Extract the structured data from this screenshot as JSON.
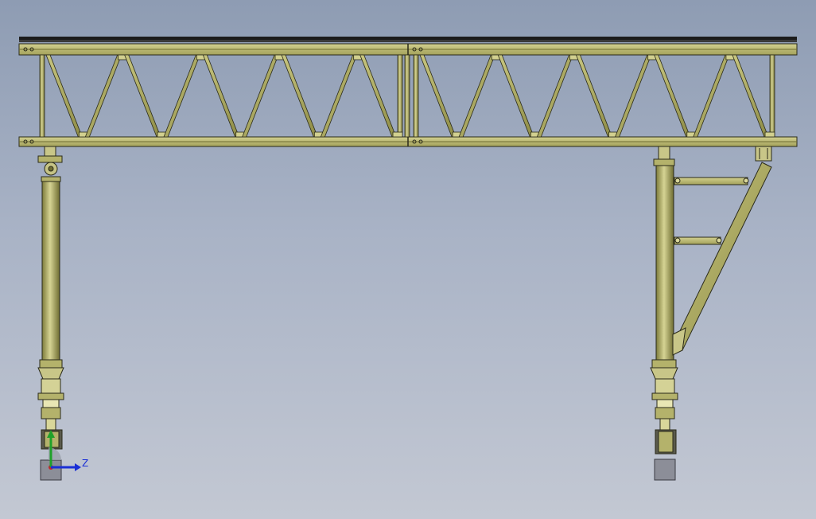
{
  "viewport": {
    "colors": {
      "background_top": "#8e9cb3",
      "background_bottom": "#c3c8d3",
      "steel": "#b4b26b",
      "steel_dark": "#6f6d32",
      "steel_light": "#d9d79a",
      "edge": "#2a2a1a",
      "foundation": "#8c8e98"
    }
  },
  "model": {
    "truss_bays_per_span": 9,
    "spans": 2
  },
  "triad": {
    "z_label": "Z",
    "y_color": "#1fa12a",
    "z_color": "#1a2fd6",
    "x_color": "#c8202a"
  }
}
